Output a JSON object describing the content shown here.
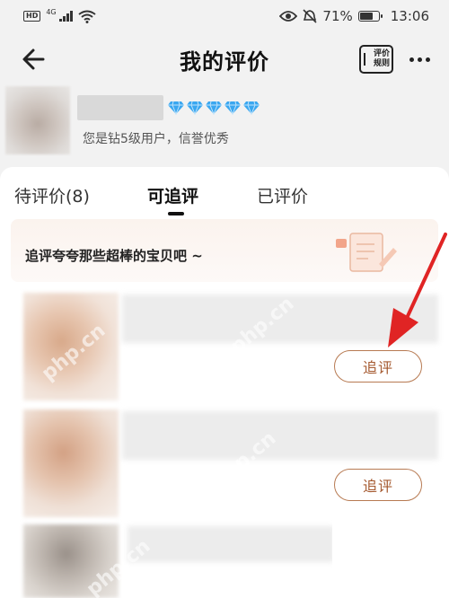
{
  "status_bar": {
    "hd": "HD",
    "network": "4G",
    "battery_percent": "71%",
    "battery_level": 0.71,
    "time": "13:06",
    "icons": [
      "hd-icon",
      "signal-icon",
      "wifi-icon",
      "eye-icon",
      "mute-bell-icon",
      "battery-icon"
    ]
  },
  "header": {
    "title": "我的评价",
    "back_icon": "arrow-left-icon",
    "rules_line1": "评价",
    "rules_line2": "规则",
    "more_icon": "more-dots-icon"
  },
  "profile": {
    "diamond_count": 5,
    "level_text": "您是钻5级用户，信誉优秀"
  },
  "tabs": [
    {
      "label": "待评价(8)",
      "active": false
    },
    {
      "label": "可追评",
      "active": true
    },
    {
      "label": "已评价",
      "active": false
    }
  ],
  "banner": {
    "text": "追评夸夸那些超棒的宝贝吧 ~"
  },
  "items": [
    {
      "button_label": "追评"
    },
    {
      "button_label": "追评"
    },
    {}
  ],
  "watermark": "php.cn",
  "colors": {
    "accent_text": "#a4582e",
    "accent_border": "#b77a52",
    "annotation_red": "#e02424",
    "diamond": "#3aa7f0"
  }
}
